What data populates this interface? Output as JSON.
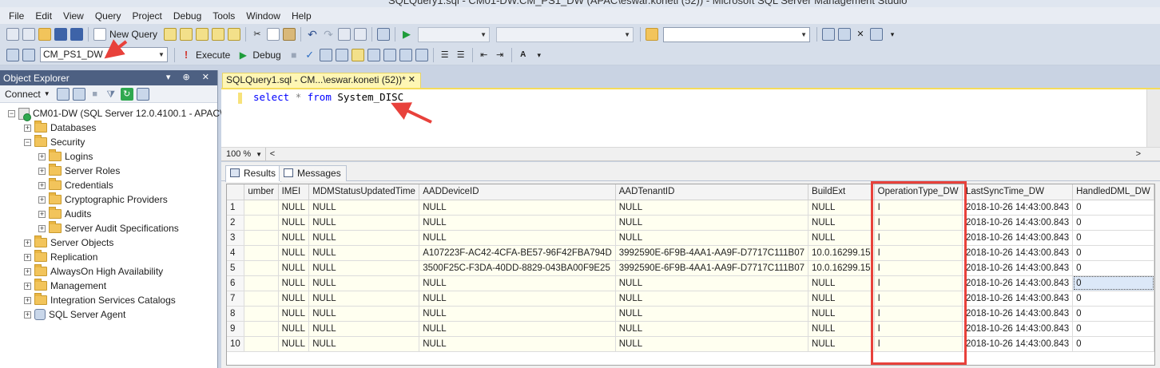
{
  "window": {
    "title": "SQLQuery1.sql - CM01-DW.CM_PS1_DW (APAC\\eswar.koneti (52)) - Microsoft SQL Server Management Studio"
  },
  "menu": [
    "File",
    "Edit",
    "View",
    "Query",
    "Project",
    "Debug",
    "Tools",
    "Window",
    "Help"
  ],
  "toolbar": {
    "new_query_label": "New Query",
    "database": "CM_PS1_DW",
    "execute_label": "Execute",
    "debug_label": "Debug"
  },
  "object_explorer": {
    "title": "Object Explorer",
    "connect_label": "Connect",
    "root": "CM01-DW (SQL Server 12.0.4100.1 - APAC\\",
    "nodes": {
      "databases": "Databases",
      "security": "Security",
      "logins": "Logins",
      "server_roles": "Server Roles",
      "credentials": "Credentials",
      "crypto": "Cryptographic Providers",
      "audits": "Audits",
      "audit_specs": "Server Audit Specifications",
      "server_objects": "Server Objects",
      "replication": "Replication",
      "alwayson": "AlwaysOn High Availability",
      "management": "Management",
      "integration": "Integration Services Catalogs",
      "agent": "SQL Server Agent"
    }
  },
  "editor": {
    "tab_label": "SQLQuery1.sql - CM...\\eswar.koneti (52))*",
    "query": {
      "kw1": "select",
      "star": "*",
      "kw2": "from",
      "table": "System_DISC"
    },
    "zoom": "100 %"
  },
  "results": {
    "tab_results": "Results",
    "tab_messages": "Messages",
    "columns": [
      "",
      "umber",
      "IMEI",
      "MDMStatusUpdatedTime",
      "AADDeviceID",
      "AADTenantID",
      "BuildExt",
      "OperationType_DW",
      "LastSyncTime_DW",
      "HandledDML_DW"
    ],
    "rows": [
      [
        "1",
        "",
        "NULL",
        "NULL",
        "NULL",
        "NULL",
        "NULL",
        "I",
        "2018-10-26 14:43:00.843",
        "0"
      ],
      [
        "2",
        "",
        "NULL",
        "NULL",
        "NULL",
        "NULL",
        "NULL",
        "I",
        "2018-10-26 14:43:00.843",
        "0"
      ],
      [
        "3",
        "",
        "NULL",
        "NULL",
        "NULL",
        "NULL",
        "NULL",
        "I",
        "2018-10-26 14:43:00.843",
        "0"
      ],
      [
        "4",
        "",
        "NULL",
        "NULL",
        "A107223F-AC42-4CFA-BE57-96F42FBA794D",
        "3992590E-6F9B-4AA1-AA9F-D7717C111B07",
        "10.0.16299.15",
        "I",
        "2018-10-26 14:43:00.843",
        "0"
      ],
      [
        "5",
        "",
        "NULL",
        "NULL",
        "3500F25C-F3DA-40DD-8829-043BA00F9E25",
        "3992590E-6F9B-4AA1-AA9F-D7717C111B07",
        "10.0.16299.15",
        "I",
        "2018-10-26 14:43:00.843",
        "0"
      ],
      [
        "6",
        "",
        "NULL",
        "NULL",
        "NULL",
        "NULL",
        "NULL",
        "I",
        "2018-10-26 14:43:00.843",
        "0"
      ],
      [
        "7",
        "",
        "NULL",
        "NULL",
        "NULL",
        "NULL",
        "NULL",
        "I",
        "2018-10-26 14:43:00.843",
        "0"
      ],
      [
        "8",
        "",
        "NULL",
        "NULL",
        "NULL",
        "NULL",
        "NULL",
        "I",
        "2018-10-26 14:43:00.843",
        "0"
      ],
      [
        "9",
        "",
        "NULL",
        "NULL",
        "NULL",
        "NULL",
        "NULL",
        "I",
        "2018-10-26 14:43:00.843",
        "0"
      ],
      [
        "10",
        "",
        "NULL",
        "NULL",
        "NULL",
        "NULL",
        "NULL",
        "I",
        "2018-10-26 14:43:00.843",
        "0"
      ]
    ]
  },
  "annotation_color": "#e8413b"
}
